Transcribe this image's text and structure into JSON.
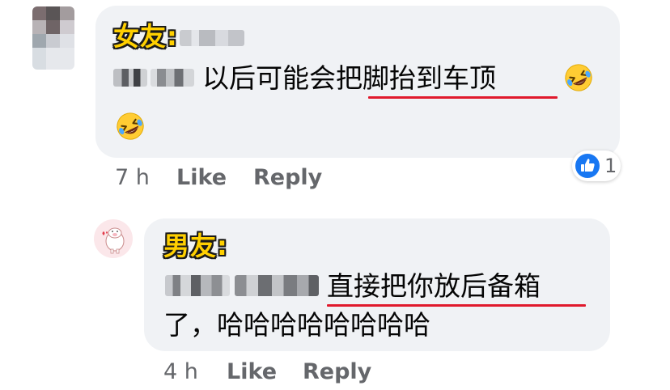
{
  "comment1": {
    "author_tag": "女友:",
    "line1_text": "以后可能会把脚抬到车顶",
    "time": "7 h",
    "like_label": "Like",
    "reply_label": "Reply",
    "reaction_count": "1",
    "reaction_icon": "like-thumb-icon",
    "emoji": "rolling-on-floor-laughing"
  },
  "comment2": {
    "author_tag": "男友:",
    "line1_text": "直接把你放后备箱",
    "line2_text": "了，哈哈哈哈哈哈哈哈",
    "time": "4 h",
    "like_label": "Like",
    "reply_label": "Reply"
  },
  "colors": {
    "bubble": "#f0f2f5",
    "tag_fill": "#ffd000",
    "underline": "#e0192c",
    "meta_text": "#65676b",
    "like_blue": "#1877f2"
  }
}
